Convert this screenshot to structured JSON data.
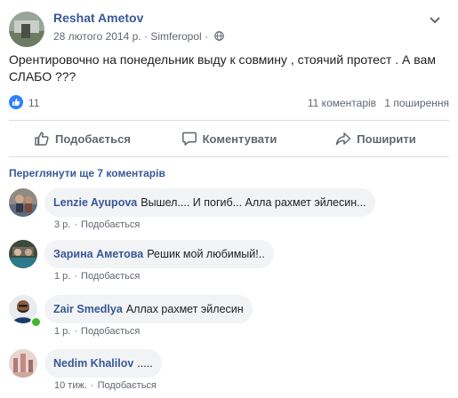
{
  "post": {
    "author": "Reshat Ametov",
    "date": "28 лютого 2014 р.",
    "separator": "·",
    "location": "Simferopol",
    "text": "Орентировочно на понедельник выду к совмину , стоячий протест . А вам СЛАБО ???"
  },
  "reactions": {
    "like_count": "11",
    "comments_count": "11 коментарів",
    "shares_count": "1 поширення"
  },
  "actions": {
    "like": "Подобається",
    "comment": "Коментувати",
    "share": "Поширити"
  },
  "view_more": "Переглянути ще 7 коментарів",
  "comments": [
    {
      "name": "Lenzie Ayupova",
      "text": "Вышел.... И погиб... Алла рахмет эйлесин...",
      "time": "3 р.",
      "like": "Подобається"
    },
    {
      "name": "Зарина Аметова",
      "text": "Решик мой любимый!..",
      "time": "1 р.",
      "like": "Подобається"
    },
    {
      "name": "Zair Smedlya",
      "text": "Аллах рахмет эйлесин",
      "time": "1 р.",
      "like": "Подобається"
    },
    {
      "name": "Nedim Khalilov",
      "text": ".....",
      "time": "10 тиж.",
      "like": "Подобається"
    }
  ],
  "colors": {
    "link": "#385898",
    "like_badge": "#2e80ff",
    "online": "#42b72a"
  }
}
